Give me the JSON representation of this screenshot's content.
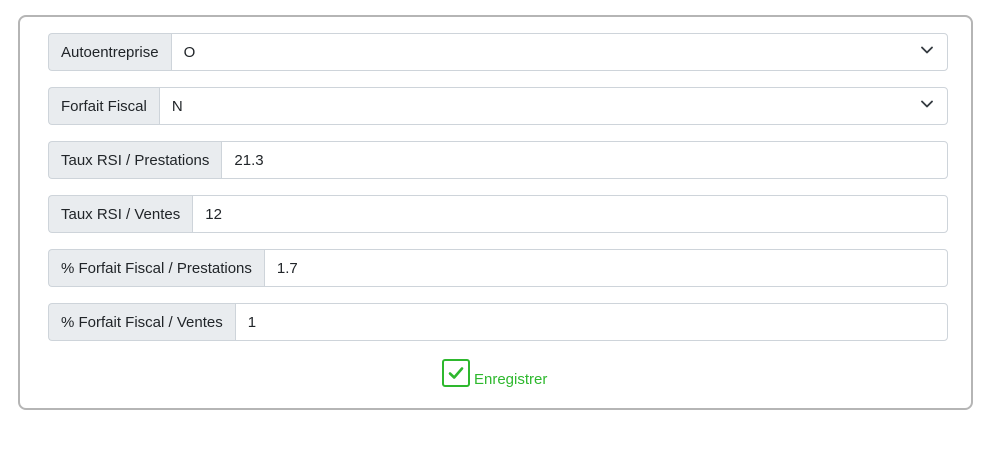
{
  "form": {
    "fields": [
      {
        "label": "Autoentreprise",
        "value": "O",
        "type": "select"
      },
      {
        "label": "Forfait Fiscal",
        "value": "N",
        "type": "select"
      },
      {
        "label": "Taux RSI / Prestations",
        "value": "21.3",
        "type": "input"
      },
      {
        "label": "Taux RSI / Ventes",
        "value": "12",
        "type": "input"
      },
      {
        "label": "% Forfait Fiscal / Prestations",
        "value": "1.7",
        "type": "input"
      },
      {
        "label": "% Forfait Fiscal / Ventes",
        "value": "1",
        "type": "input"
      }
    ],
    "save_label": "Enregistrer"
  },
  "icons": {
    "select_arrow": "chevron-down-icon",
    "save": "check-icon"
  },
  "colors": {
    "accent_green": "#2eb82e",
    "addon_bg": "#e9ecef",
    "border": "#ced4da"
  }
}
